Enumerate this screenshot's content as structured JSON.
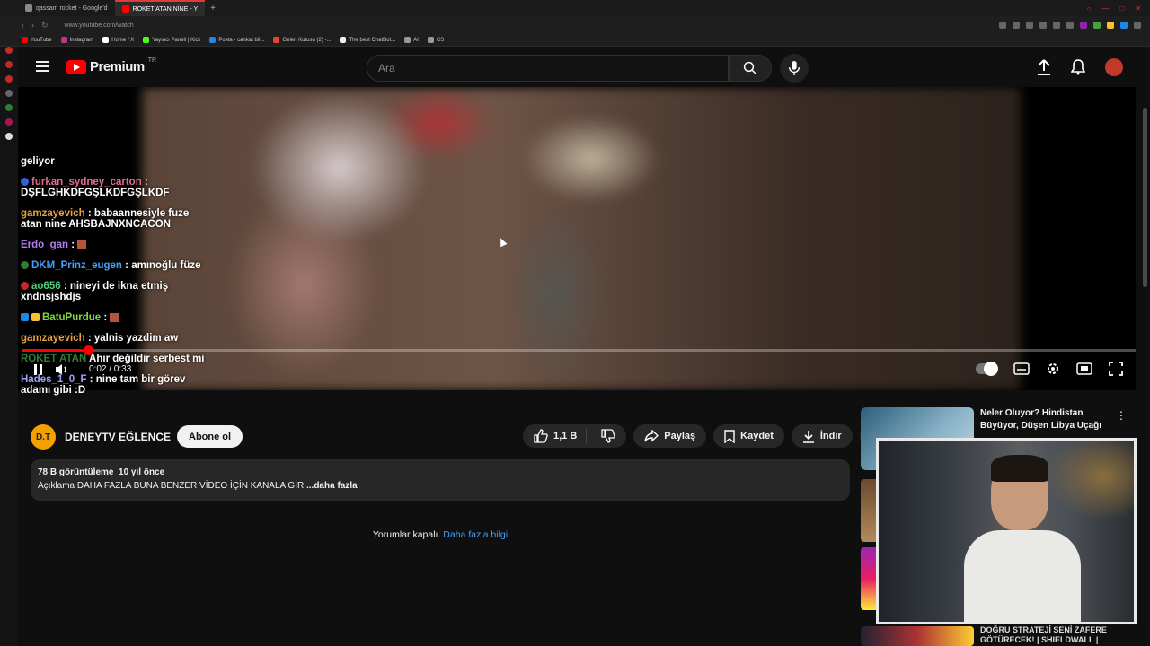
{
  "browser": {
    "tabs": [
      {
        "label": "qassam rocket - Google'd",
        "active": false
      },
      {
        "label": "ROKET ATAN NİNE - Y",
        "active": true
      }
    ],
    "url": "www.youtube.com/watch",
    "bookmarks": [
      "YouTube",
      "Instagram",
      "Home / X",
      "Yayıncı Paneli | Kick",
      "Posta - cankat bil...",
      "Gelen Kutusu (2) -...",
      "The best ChatBot...",
      "AI",
      "CS"
    ]
  },
  "header": {
    "logo_text": "Premium",
    "country": "TR",
    "search_placeholder": "Ara"
  },
  "player": {
    "time": "0:02 / 0:33",
    "progress": 0.06
  },
  "chat": [
    {
      "user": "",
      "text": "geliyor",
      "color": "#ffffff"
    },
    {
      "user": "furkan_sydney_carton",
      "text": ": DŞFLGHKDFGŞLKDFGŞLKDF",
      "color": "#e06c8a"
    },
    {
      "user": "gamzayevich",
      "text": ": babaannesiyle fuze atan nine AHSBAJNXNCACON",
      "color": "#e8a33c"
    },
    {
      "user": "Erdo_gan",
      "text": ":",
      "color": "#b47cf0"
    },
    {
      "user": "DKM_Prinz_eugen",
      "text": ": amınoğlu füze",
      "color": "#3fa0ff"
    },
    {
      "user": "ao656",
      "text": ": nineyi de ikna etmiş xndnsjshdjs",
      "color": "#4fd07a"
    },
    {
      "user": "BatuPurdue",
      "text": ":",
      "color": "#7ddc3a"
    },
    {
      "user": "gamzayevich",
      "text": ": yalnis yazdim aw",
      "color": "#e8a33c"
    },
    {
      "user": "ROKET ATAN",
      "text": "Ahır değildir serbest mi",
      "color": "#f0f0f0"
    },
    {
      "user": "Hades_1_0_F",
      "text": ": nine tam bir görev adamı gibi :D",
      "color": "#9aa0ff"
    }
  ],
  "video": {
    "channel_name": "DENEYTV EĞLENCE",
    "channel_initials": "D.T",
    "subscribe_label": "Abone ol",
    "likes": "1,1 B",
    "share_label": "Paylaş",
    "save_label": "Kaydet",
    "download_label": "İndir",
    "views": "78 B görüntüleme",
    "age": "10 yıl önce",
    "description": "Açıklama DAHA FAZLA BUNA BENZER VİDEO İÇİN KANALA GİR",
    "more_label": "...daha fazla"
  },
  "comments": {
    "status": "Yorumlar kapalı.",
    "link": "Daha fazla bilgi"
  },
  "sidebar": {
    "rec1_title": "Neler Oluyor? Hindistan Büyüyor, Düşen Libya Uçağı",
    "rec2_title": "DOĞRU STRATEJİ SENİ ZAFERE GÖTÜRECEK! | SHIELDWALL |"
  },
  "colors": {
    "accent": "#ff0000",
    "link": "#3ea6ff",
    "background": "#0f0f0f"
  }
}
